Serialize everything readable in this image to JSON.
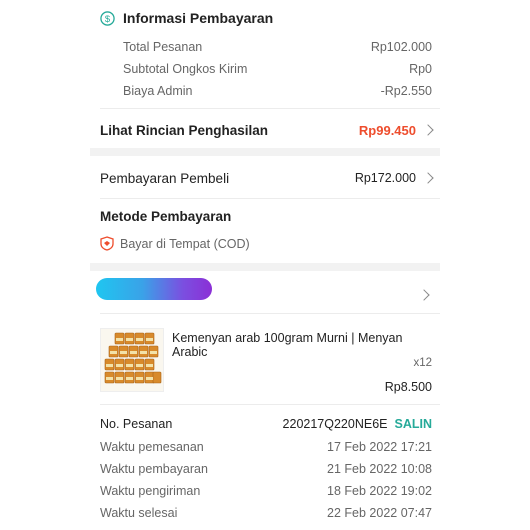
{
  "payment_info": {
    "title": "Informasi Pembayaran",
    "lines": [
      {
        "label": "Total Pesanan",
        "value": "Rp102.000"
      },
      {
        "label": "Subtotal Ongkos Kirim",
        "value": "Rp0"
      },
      {
        "label": "Biaya Admin",
        "value": "-Rp2.550"
      }
    ]
  },
  "income": {
    "label": "Lihat Rincian Penghasilan",
    "value": "Rp99.450",
    "color": "#ee4d2d"
  },
  "buyer_payment": {
    "label": "Pembayaran Pembeli",
    "value": "Rp172.000"
  },
  "method": {
    "title": "Metode Pembayaran",
    "option": "Bayar di Tempat (COD)"
  },
  "product": {
    "name": "Kemenyan arab 100gram Murni | Menyan Arabic",
    "qty": "x12",
    "price": "Rp8.500"
  },
  "order": {
    "no_label": "No. Pesanan",
    "no_value": "220217Q220NE6E",
    "copy": "SALIN",
    "times": [
      {
        "label": "Waktu pemesanan",
        "value": "17 Feb 2022 17:21"
      },
      {
        "label": "Waktu pembayaran",
        "value": "21 Feb 2022 10:08"
      },
      {
        "label": "Waktu pengiriman",
        "value": "18 Feb 2022 19:02"
      },
      {
        "label": "Waktu selesai",
        "value": "22 Feb 2022 07:47"
      }
    ]
  },
  "colors": {
    "accent": "#ee4d2d",
    "teal": "#26aa99"
  },
  "icons": {
    "payment": "dollar-circle-icon",
    "cod": "shield-cod-icon",
    "chevron": "chevron-right-icon"
  }
}
